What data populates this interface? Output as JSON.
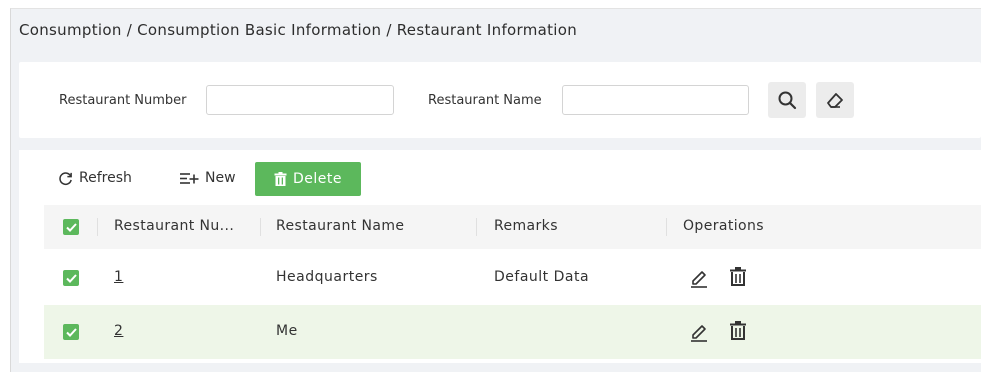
{
  "breadcrumb": "Consumption / Consumption Basic Information / Restaurant Information",
  "search": {
    "restaurant_number_label": "Restaurant Number",
    "restaurant_number_value": "",
    "restaurant_name_label": "Restaurant Name",
    "restaurant_name_value": "",
    "search_icon": "search-icon",
    "clear_icon": "eraser-icon"
  },
  "toolbar": {
    "refresh_label": "Refresh",
    "new_label": "New",
    "delete_label": "Delete"
  },
  "colors": {
    "accent_green": "#5cb85c",
    "selected_row": "#eef6e8",
    "page_bg": "#f0f2f5"
  },
  "table": {
    "columns": [
      "Restaurant Nu...",
      "Restaurant Name",
      "Remarks",
      "Operations"
    ],
    "rows": [
      {
        "number": "1",
        "name": "Headquarters",
        "remarks": "Default Data",
        "checked": true
      },
      {
        "number": "2",
        "name": "Me",
        "remarks": "",
        "checked": true
      }
    ]
  }
}
